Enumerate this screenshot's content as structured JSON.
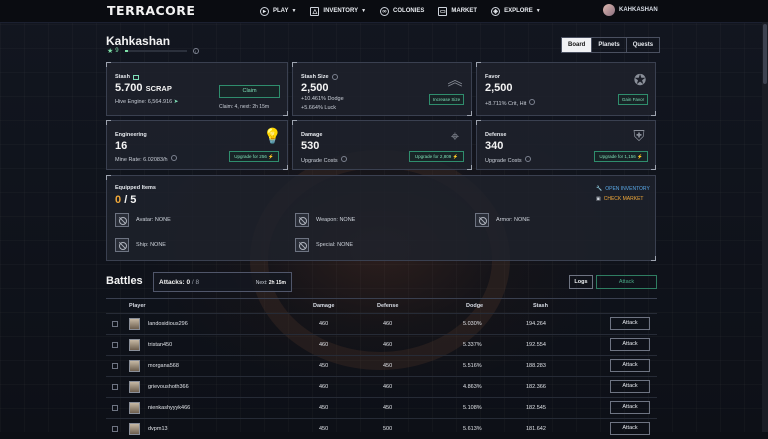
{
  "nav": {
    "logo": "TERRACORE",
    "menu": [
      {
        "label": "PLAY",
        "icon": "play-icon",
        "dropdown": true
      },
      {
        "label": "INVENTORY",
        "icon": "inventory-icon",
        "dropdown": true
      },
      {
        "label": "COLONIES",
        "icon": "colonies-icon",
        "dropdown": false
      },
      {
        "label": "MARKET",
        "icon": "market-icon",
        "dropdown": false
      },
      {
        "label": "EXPLORE",
        "icon": "explore-icon",
        "dropdown": true
      }
    ],
    "username": "KAHKASHAN"
  },
  "profile": {
    "name": "Kahkashan",
    "level": "9",
    "level_progress": 0.06
  },
  "tabs": [
    "Board",
    "Planets",
    "Quests"
  ],
  "active_tab": "Board",
  "cards": {
    "stash": {
      "title": "Stash",
      "value": "5.700",
      "unit": "SCRAP",
      "hive_engine": "Hive Engine: 6,564.916",
      "claim_button": "Claim",
      "claim_info": "Claim: 4, next: 2h 15m"
    },
    "stash_size": {
      "title": "Stash Size",
      "value": "2,500",
      "dodge": "+10.461% Dodge",
      "luck": "+5.664% Luck",
      "button": "Increase Size"
    },
    "favor": {
      "title": "Favor",
      "value": "2,500",
      "crit": "+8.711% Crit, Hit",
      "button": "Gain Favor"
    },
    "engineering": {
      "title": "Engineering",
      "value": "16",
      "mine_rate": "Mine Rate: 6.02083/h",
      "button": "Upgrade for 256"
    },
    "damage": {
      "title": "Damage",
      "value": "530",
      "sub": "Upgrade Costs",
      "button": "Upgrade for 2,809"
    },
    "defense": {
      "title": "Defense",
      "value": "340",
      "sub": "Upgrade Costs",
      "button": "Upgrade for 1,156"
    }
  },
  "equipment": {
    "title": "Equipped Items",
    "count": "0",
    "total": "/ 5",
    "open_inventory": "OPEN INVENTORY",
    "check_market": "CHECK MARKET",
    "slots": [
      "Avatar: NONE",
      "Weapon: NONE",
      "Armor: NONE",
      "Ship: NONE",
      "Special: NONE"
    ]
  },
  "battles": {
    "title": "Battles",
    "attacks_label": "Attacks:",
    "attacks_value": "0",
    "attacks_max": "/ 8",
    "next_label": "Next:",
    "next_value": "2h 15m",
    "logs_button": "Logs",
    "attack_button": "Attack",
    "columns": [
      "Player",
      "Damage",
      "Defense",
      "Dodge",
      "Stash"
    ],
    "rows": [
      {
        "player": "landosidious296",
        "damage": "460",
        "defense": "460",
        "dodge": "5.030%",
        "stash": "194.264",
        "action": "Attack"
      },
      {
        "player": "tristan450",
        "damage": "460",
        "defense": "460",
        "dodge": "5.337%",
        "stash": "192.554",
        "action": "Attack"
      },
      {
        "player": "morgana568",
        "damage": "450",
        "defense": "450",
        "dodge": "5.516%",
        "stash": "188.283",
        "action": "Attack"
      },
      {
        "player": "grievoushoth366",
        "damage": "460",
        "defense": "460",
        "dodge": "4.863%",
        "stash": "182.366",
        "action": "Attack"
      },
      {
        "player": "nienkashyyyk466",
        "damage": "450",
        "defense": "450",
        "dodge": "5.108%",
        "stash": "182.545",
        "action": "Attack"
      },
      {
        "player": "dvpm13",
        "damage": "450",
        "defense": "500",
        "dodge": "5.613%",
        "stash": "181.642",
        "action": "Attack"
      }
    ]
  }
}
